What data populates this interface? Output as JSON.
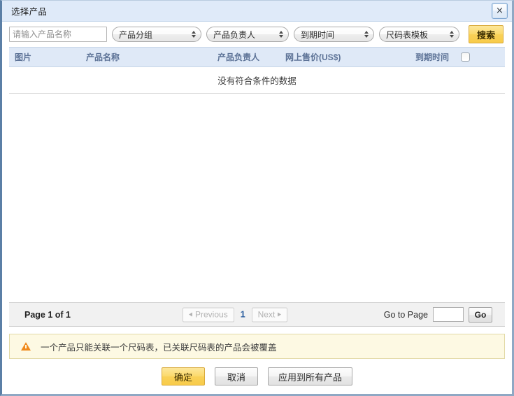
{
  "dialog": {
    "title": "选择产品",
    "close_label": "×"
  },
  "search": {
    "placeholder": "请输入产品名称",
    "value": "",
    "filters": [
      {
        "label": "产品分组"
      },
      {
        "label": "产品负责人"
      },
      {
        "label": "到期时间"
      },
      {
        "label": "尺码表模板"
      }
    ],
    "search_button": "搜索"
  },
  "table": {
    "columns": [
      {
        "key": "image",
        "label": "图片"
      },
      {
        "key": "name",
        "label": "产品名称"
      },
      {
        "key": "owner",
        "label": "产品负责人"
      },
      {
        "key": "price",
        "label": "网上售价(US$)"
      },
      {
        "key": "expire",
        "label": "到期时间"
      }
    ],
    "select_all_checked": false,
    "rows": [],
    "empty_message": "没有符合条件的数据"
  },
  "pager": {
    "page_label": "Page 1 of 1",
    "previous_label": "Previous",
    "next_label": "Next",
    "current_page": "1",
    "goto_label": "Go to Page",
    "goto_value": "",
    "go_button": "Go",
    "previous_enabled": false,
    "next_enabled": false
  },
  "notice": {
    "icon": "warning-triangle-icon",
    "text": "一个产品只能关联一个尺码表，已关联尺码表的产品会被覆盖"
  },
  "footer": {
    "confirm_label": "确定",
    "cancel_label": "取消",
    "apply_all_label": "应用到所有产品"
  },
  "colors": {
    "titlebar_bg": "#dfeaf9",
    "accent_yellow": "#f9d158",
    "header_text": "#5c7296",
    "link_blue": "#2a5d9e",
    "notice_bg": "#fdf9e3",
    "notice_border": "#e2d9a6",
    "warning_orange": "#f08a1d"
  }
}
